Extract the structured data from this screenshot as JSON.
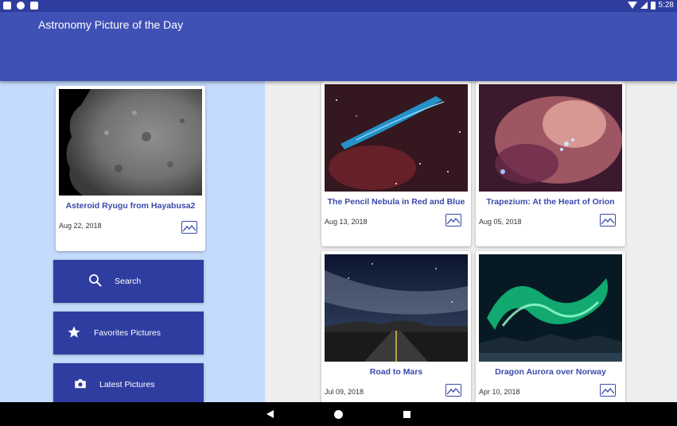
{
  "app_title": "Astronomy Picture of the Day",
  "status_bar": {
    "time": "5:28"
  },
  "featured": {
    "title": "Asteroid Ryugu from Hayabusa2",
    "date": "Aug 22, 2018",
    "image_icon": "image-icon"
  },
  "menu": [
    {
      "label": "Search",
      "icon": "search-icon"
    },
    {
      "label": "Favorites Pictures",
      "icon": "star-icon"
    },
    {
      "label": "Latest Pictures",
      "icon": "camera-icon"
    }
  ],
  "gallery": [
    {
      "title": "The Pencil Nebula in Red and Blue",
      "date": "Aug 13, 2018"
    },
    {
      "title": "Trapezium: At the Heart of Orion",
      "date": "Aug 05, 2018"
    },
    {
      "title": "Road to Mars",
      "date": "Jul 09, 2018"
    },
    {
      "title": "Dragon Aurora over Norway",
      "date": "Apr 10, 2018"
    }
  ],
  "nav": {
    "back": "back-icon",
    "home": "home-icon",
    "recents": "recents-icon"
  }
}
